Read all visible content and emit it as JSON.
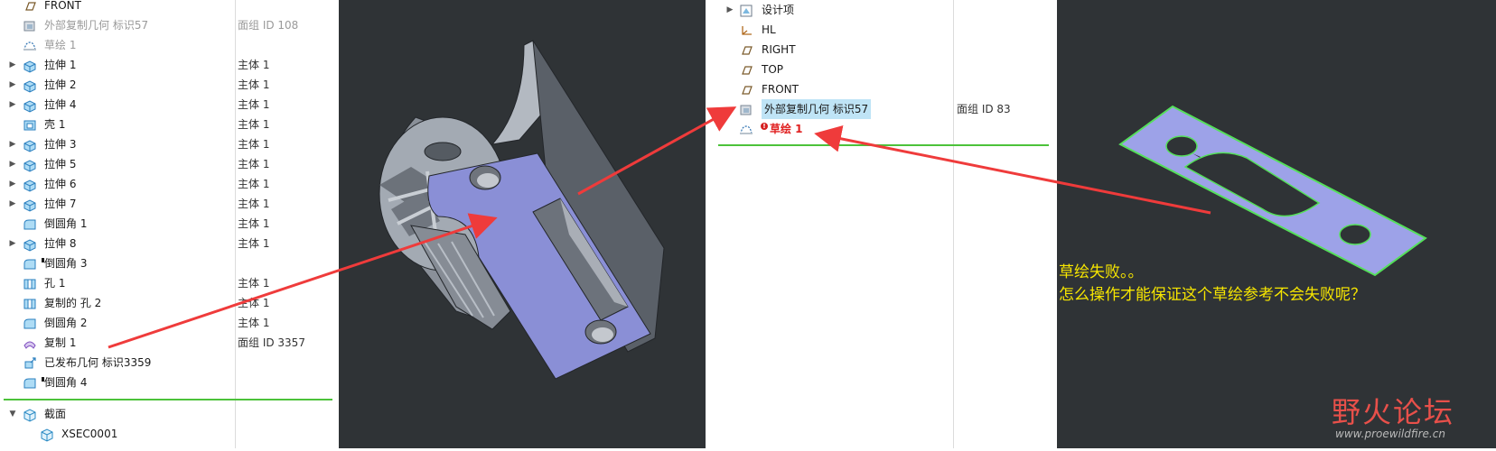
{
  "left_tree": {
    "rows": [
      {
        "label": "FRONT",
        "col2": "",
        "icon": "datum-plane-icon",
        "expander": false,
        "dim": false
      },
      {
        "label": "外部复制几何 标识57",
        "col2": "面组 ID 108",
        "icon": "external-copy-geometry-icon",
        "expander": false,
        "dim": true
      },
      {
        "label": "草绘 1",
        "col2": "",
        "icon": "sketch-icon",
        "expander": false,
        "dim": true
      },
      {
        "label": "拉伸 1",
        "col2": "主体 1",
        "icon": "extrude-icon",
        "expander": true,
        "dim": false
      },
      {
        "label": "拉伸 2",
        "col2": "主体 1",
        "icon": "extrude-icon",
        "expander": true,
        "dim": false
      },
      {
        "label": "拉伸 4",
        "col2": "主体 1",
        "icon": "extrude-icon",
        "expander": true,
        "dim": false
      },
      {
        "label": "壳 1",
        "col2": "主体 1",
        "icon": "shell-icon",
        "expander": false,
        "dim": false
      },
      {
        "label": "拉伸 3",
        "col2": "主体 1",
        "icon": "extrude-icon",
        "expander": true,
        "dim": false
      },
      {
        "label": "拉伸 5",
        "col2": "主体 1",
        "icon": "extrude-icon",
        "expander": true,
        "dim": false
      },
      {
        "label": "拉伸 6",
        "col2": "主体 1",
        "icon": "extrude-icon",
        "expander": true,
        "dim": false
      },
      {
        "label": "拉伸 7",
        "col2": "主体 1",
        "icon": "extrude-icon",
        "expander": true,
        "dim": false
      },
      {
        "label": "倒圆角 1",
        "col2": "主体 1",
        "icon": "round-icon",
        "expander": false,
        "dim": false
      },
      {
        "label": "拉伸 8",
        "col2": "主体 1",
        "icon": "extrude-icon",
        "expander": true,
        "dim": false
      },
      {
        "label": "倒圆角 3",
        "col2": "",
        "icon": "round-icon",
        "expander": false,
        "dim": false,
        "marker": true
      },
      {
        "label": "孔 1",
        "col2": "主体 1",
        "icon": "hole-icon",
        "expander": false,
        "dim": false
      },
      {
        "label": "复制的 孔 2",
        "col2": "主体 1",
        "icon": "hole-icon",
        "expander": false,
        "dim": false
      },
      {
        "label": "倒圆角 2",
        "col2": "主体 1",
        "icon": "round-icon",
        "expander": false,
        "dim": false
      },
      {
        "label": "复制 1",
        "col2": "面组 ID 3357",
        "icon": "copy-surface-icon",
        "expander": false,
        "dim": false
      },
      {
        "label": "已发布几何 标识3359",
        "col2": "",
        "icon": "publish-geometry-icon",
        "expander": false,
        "dim": false
      },
      {
        "label": "倒圆角 4",
        "col2": "",
        "icon": "round-icon",
        "expander": false,
        "dim": false,
        "marker": true
      }
    ],
    "section_node": {
      "label": "截面",
      "icon": "section-folder-icon"
    },
    "section_child": {
      "label": "XSEC0001",
      "icon": "xsec-icon"
    }
  },
  "right_tree": {
    "rows": [
      {
        "label": "设计项",
        "icon": "design-items-icon",
        "expander": true
      },
      {
        "label": "HL",
        "icon": "coordinate-system-icon",
        "expander": false
      },
      {
        "label": "RIGHT",
        "icon": "datum-plane-icon",
        "expander": false
      },
      {
        "label": "TOP",
        "icon": "datum-plane-icon",
        "expander": false
      },
      {
        "label": "FRONT",
        "icon": "datum-plane-icon",
        "expander": false
      },
      {
        "label": "外部复制几何 标识57",
        "col2": "面组 ID 83",
        "icon": "external-copy-geometry-icon",
        "expander": false,
        "selected": true
      },
      {
        "label": "草绘 1",
        "icon": "sketch-icon",
        "expander": false,
        "failed": true
      }
    ]
  },
  "annotation": {
    "line1": "草绘失败。。",
    "line2": "怎么操作才能保证这个草绘参考不会失败呢？"
  },
  "watermark": {
    "main": "野火论坛",
    "sub": "www.proewildfire.cn"
  },
  "colors": {
    "viewport_bg": "#2f3336",
    "part_face_gray": "#a3aab3",
    "part_face_purple": "#8a8fd6",
    "sketch_fill": "#9da2e8",
    "sketch_edge": "#55e05a",
    "arrow_red": "#ef3b3b",
    "annotation_yellow": "#f7e600",
    "failed_red": "#e02020",
    "selection_blue": "#bfe4f6"
  }
}
